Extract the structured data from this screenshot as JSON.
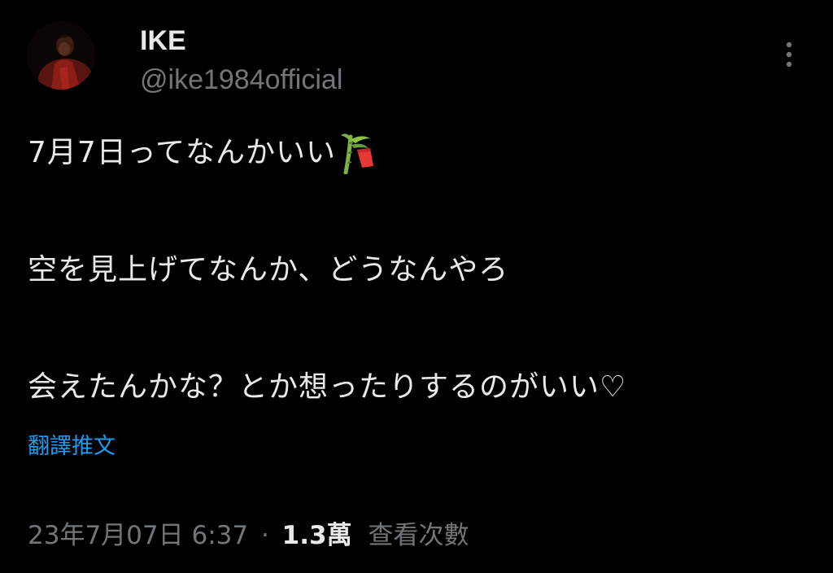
{
  "author": {
    "display_name": "IKE",
    "handle": "@ike1984official"
  },
  "tweet": {
    "line1": "7月7日ってなんかいい",
    "line1_icon": "tanabata-tree-icon",
    "line2": "空を見上げてなんか、どうなんやろ",
    "line3": "会えたんかな？とか想ったりするのがいい♡"
  },
  "translate_label": "翻譯推文",
  "meta": {
    "timestamp": "23年7月07日 6:37",
    "separator": "·",
    "views_count": "1.3萬",
    "views_label": "查看次數"
  },
  "colors": {
    "background": "#000000",
    "text_primary": "#e7e9ea",
    "text_secondary": "#71767b",
    "link_blue": "#1d9bf0"
  },
  "icons": {
    "more": "more-vertical-icon",
    "avatar": "avatar-image"
  }
}
